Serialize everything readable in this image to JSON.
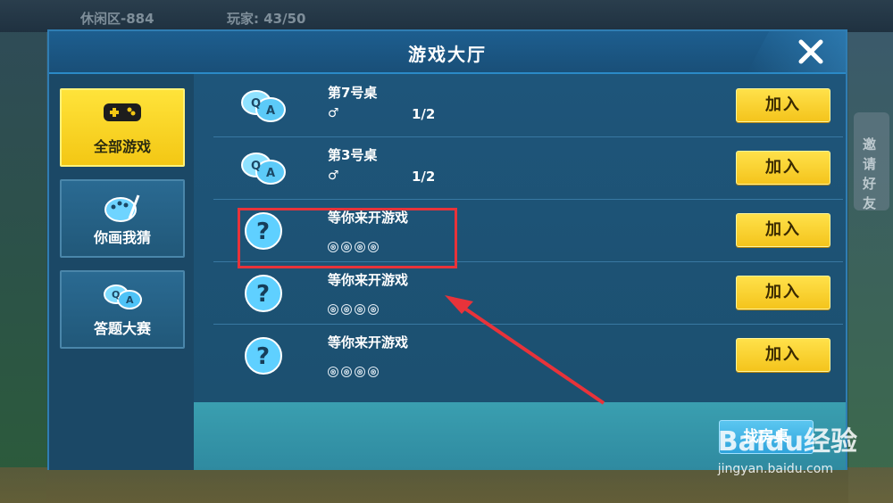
{
  "background": {
    "top_left_text": "休闲区-884",
    "top_mid_text": "玩家: 43/50",
    "right_vertical_text": "邀请好友"
  },
  "dialog": {
    "title": "游戏大厅",
    "close_icon": "close-icon"
  },
  "sidebar": {
    "tabs": [
      {
        "label": "全部游戏",
        "icon": "gamepad-icon",
        "active": true
      },
      {
        "label": "你画我猜",
        "icon": "palette-icon",
        "active": false
      },
      {
        "label": "答题大赛",
        "icon": "qa-icon",
        "active": false
      }
    ]
  },
  "rooms": [
    {
      "title": "第7号桌",
      "gender_symbol": "♂",
      "count": "1/2",
      "icon": "qa-icon",
      "join_label": "加入"
    },
    {
      "title": "第3号桌",
      "gender_symbol": "♂",
      "count": "1/2",
      "icon": "qa-icon",
      "join_label": "加入"
    },
    {
      "title": "等你来开游戏",
      "slots": [
        "⊗",
        "⊗",
        "⊗",
        "⊗"
      ],
      "icon": "question-icon",
      "join_label": "加入"
    },
    {
      "title": "等你来开游戏",
      "slots": [
        "⊗",
        "⊗",
        "⊗",
        "⊗"
      ],
      "icon": "question-icon",
      "join_label": "加入"
    },
    {
      "title": "等你来开游戏",
      "slots": [
        "⊗",
        "⊗",
        "⊗",
        "⊗"
      ],
      "icon": "question-icon",
      "join_label": "加入"
    }
  ],
  "footer": {
    "find_label": "找房桌"
  },
  "watermark": {
    "logo": "Baidu经验",
    "url": "jingyan.baidu.com"
  },
  "colors": {
    "accent_yellow": "#f4c41c",
    "dialog_blue": "#1c4a6b",
    "annotation_red": "#e8333a"
  }
}
